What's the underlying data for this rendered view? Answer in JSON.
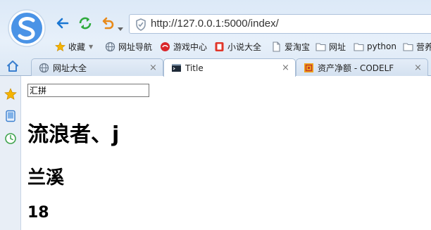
{
  "browser": {
    "address_bar": {
      "url": "http://127.0.0.1:5000/index/"
    },
    "bookmarks": [
      {
        "label": "收藏",
        "icon": "star-icon"
      },
      {
        "label": "网址导航",
        "icon": "globe-icon"
      },
      {
        "label": "游戏中心",
        "icon": "game-icon"
      },
      {
        "label": "小说大全",
        "icon": "book-icon"
      },
      {
        "label": "爱淘宝",
        "icon": "page-icon"
      },
      {
        "label": "网址",
        "icon": "folder-icon"
      },
      {
        "label": "python",
        "icon": "folder-icon"
      },
      {
        "label": "营养",
        "icon": "folder-icon"
      }
    ],
    "tabs": [
      {
        "label": "网址大全",
        "icon": "globe-icon",
        "active": false
      },
      {
        "label": "Title",
        "icon": "terminal-icon",
        "active": true
      },
      {
        "label": "资产净额 - CODELF",
        "icon": "codelf-icon",
        "active": false
      }
    ],
    "close_glyph": "×"
  },
  "page": {
    "input_value": "汇拼",
    "heading1": "流浪者、j",
    "heading2": "兰溪",
    "heading3": "18"
  },
  "colors": {
    "accent_blue": "#1a76d2",
    "refresh_green": "#2eaa3c",
    "undo_orange": "#e88a1a"
  }
}
